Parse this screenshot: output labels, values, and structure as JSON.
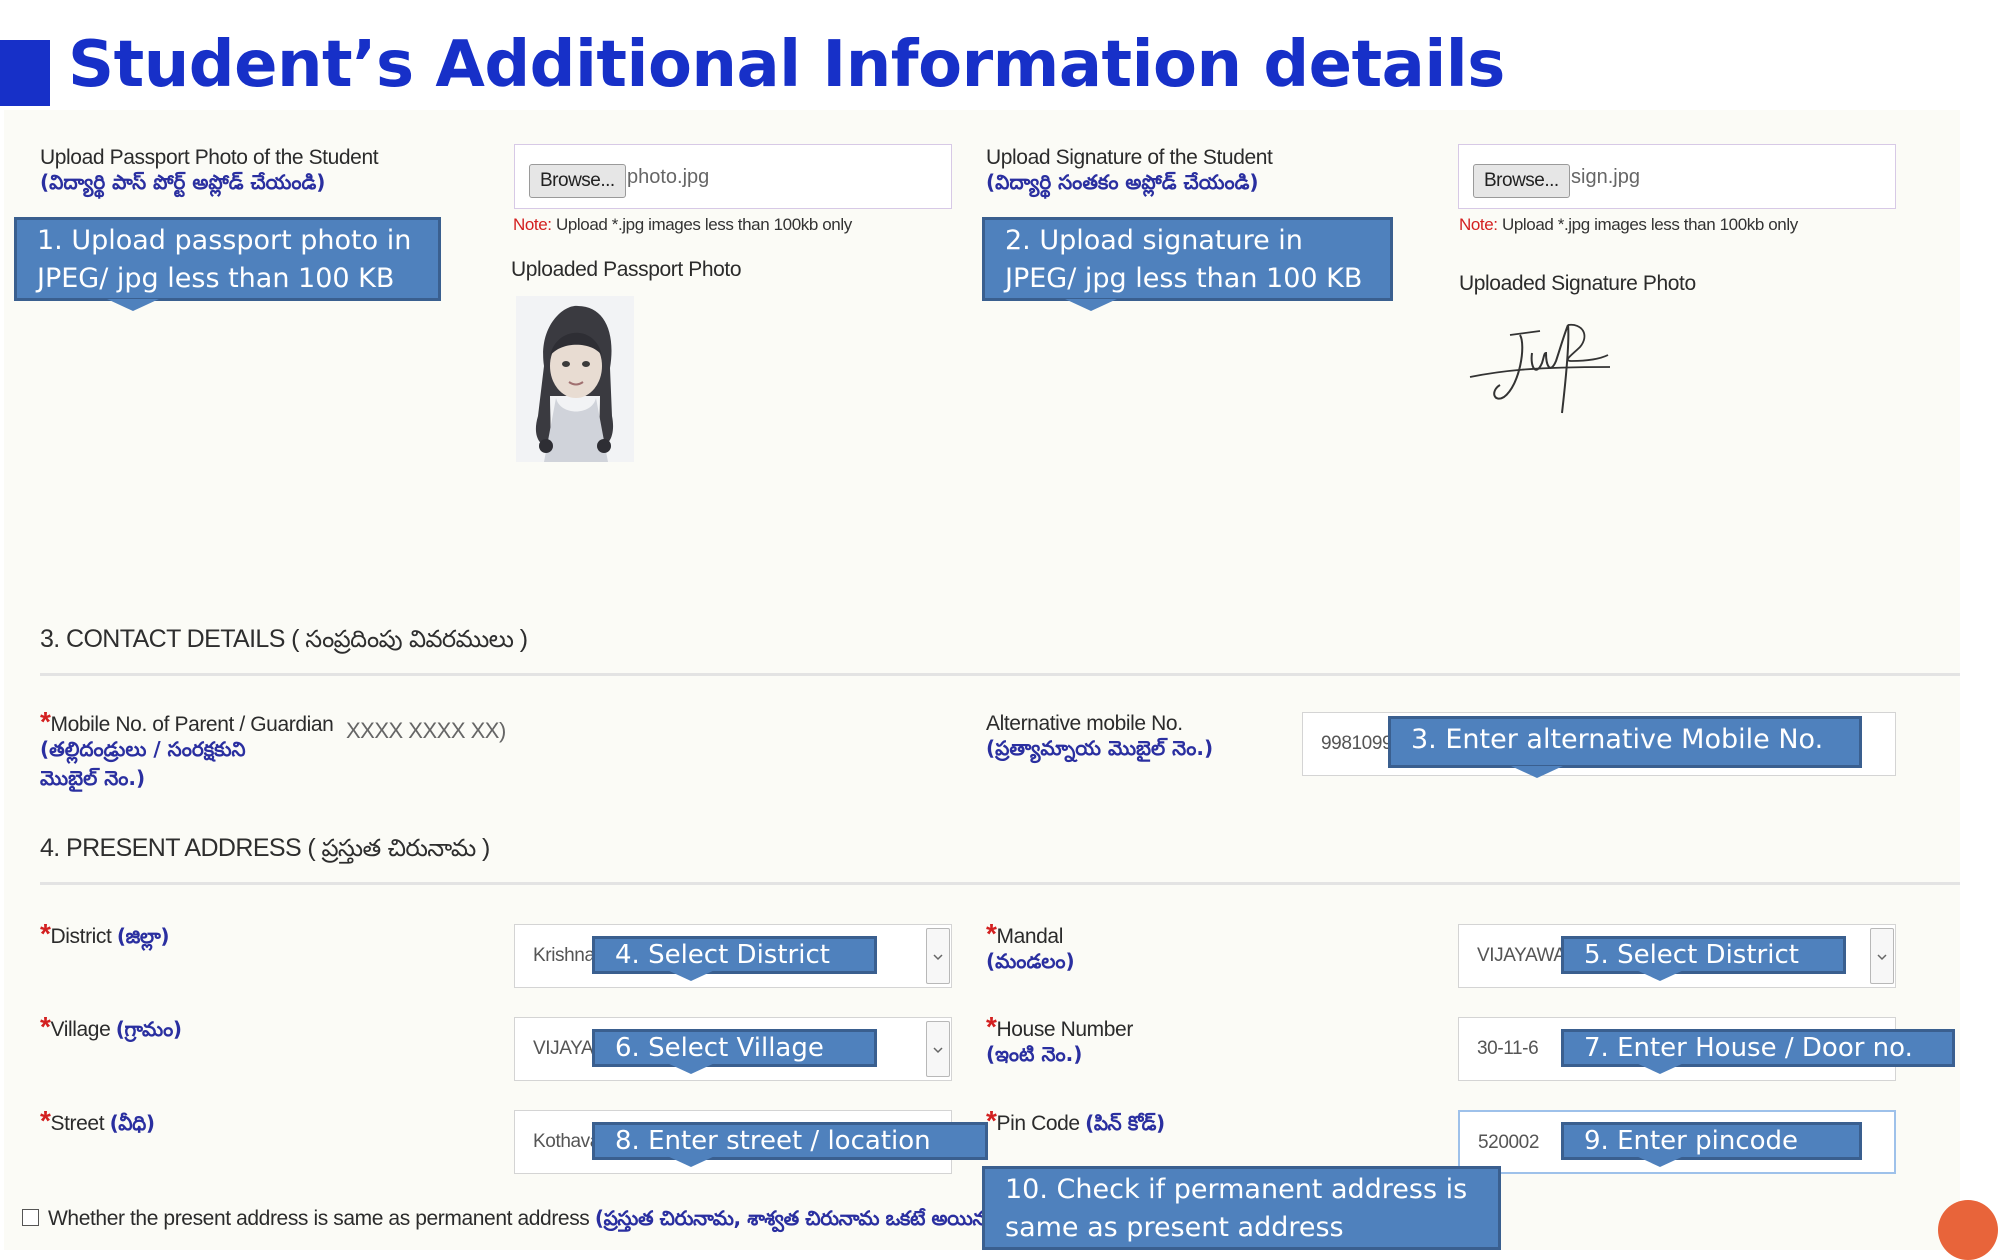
{
  "page_title": "Student’s Additional Information details",
  "uploads": {
    "passport": {
      "label_en": "Upload Passport Photo of the Student",
      "label_te": "(విద్యార్థి పాస్ పోర్ట్ అప్లోడ్ చేయండి)",
      "browse_label": "Browse...",
      "file_name": "photo.jpg",
      "note_key": "Note:",
      "note_text": " Upload *.jpg images less than 100kb only",
      "uploaded_title": "Uploaded Passport Photo"
    },
    "signature": {
      "label_en": "Upload Signature of the Student",
      "label_te": "(విద్యార్థి సంతకం అప్లోడ్ చేయండి)",
      "browse_label": "Browse...",
      "file_name": "sign.jpg",
      "note_key": "Note:",
      "note_text": " Upload *.jpg images less than 100kb only",
      "uploaded_title": "Uploaded Signature Photo"
    }
  },
  "contact": {
    "section_en": "3. CONTACT DETAILS ( ",
    "section_te": "సంప్రదింపు వివరములు",
    "section_close": " )",
    "mobile_label_en": "Mobile No. of Parent / Guardian",
    "mobile_label_te_1": "(తల్లిదండ్రులు / సంరక్షకుని",
    "mobile_label_te_2": "మొబైల్ నెం.)",
    "mobile_value": "XXXX XXXX XX)",
    "alt_label_en": "Alternative mobile No.",
    "alt_label_te": "(ప్రత్యామ్నాయ మొబైల్ నెం.)",
    "alt_value": "9981099"
  },
  "address": {
    "section_en": "4. PRESENT ADDRESS ( ",
    "section_te": "ప్రస్తుత చిరునామ",
    "section_close": " )",
    "district_label_en": "District ",
    "district_label_te": "(జిల్లా)",
    "district_value": "Krishna",
    "mandal_label_en": "Mandal",
    "mandal_label_te": "(మండలం)",
    "mandal_value": "VIJAYAWA",
    "village_label_en": "Village ",
    "village_label_te": "(గ్రామం)",
    "village_value": "VIJAYA",
    "house_label_en": "House Number",
    "house_label_te": "(ఇంటి నెం.)",
    "house_value": "30-11-6",
    "street_label_en": "Street ",
    "street_label_te": "(వీధి)",
    "street_value": "Kothava",
    "pincode_label_en": "Pin Code ",
    "pincode_label_te": "(పిన్ కోడ్)",
    "pincode_value": "520002",
    "same_address_label_en": "Whether the present address is same as permanent address ",
    "same_address_label_te": "(ప్రస్తుత చిరునామ, శాశ్వత చిరునామ ఒకటే అయినచో"
  },
  "callouts": {
    "c1_line1": "1. Upload passport photo in",
    "c1_line2": "JPEG/ jpg less than 100 KB",
    "c2_line1": "2. Upload signature in",
    "c2_line2": "JPEG/ jpg less than 100 KB",
    "c3": "3. Enter alternative Mobile No.",
    "c4": "4. Select District",
    "c5": "5. Select District",
    "c6": "6. Select Village",
    "c7": "7. Enter House / Door no.",
    "c8": "8. Enter  street / location",
    "c9": "9. Enter  pincode",
    "c10_line1": "10. Check if permanent address is",
    "c10_line2": "same as present address"
  },
  "colors": {
    "title_blue": "#1730c8",
    "callout_fill": "#4f81bd",
    "callout_border": "#3a5f8f",
    "required_red": "#d32020",
    "telugu_label_blue": "#2a2fa0"
  },
  "icons": {
    "dropdown": "chevron-down-icon",
    "checkbox": "checkbox-icon"
  }
}
